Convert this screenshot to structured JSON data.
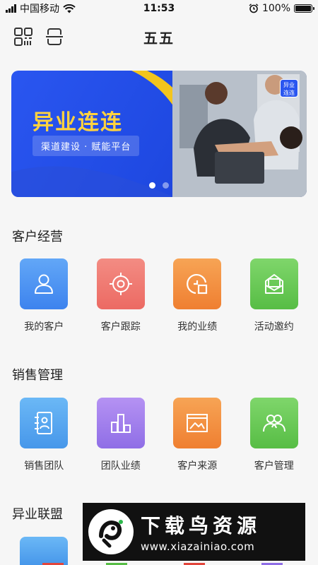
{
  "status_bar": {
    "carrier": "中国移动",
    "time": "11:53",
    "battery": "100%"
  },
  "header": {
    "title": "五五",
    "left_icons": [
      "qr-grid-icon",
      "scan-icon"
    ]
  },
  "banner": {
    "title": "异业连连",
    "subtitle": "渠道建设 · 赋能平台",
    "badge": "异业\n连连",
    "slide_count": 2,
    "active_slide": 1
  },
  "sections": [
    {
      "title": "客户经营",
      "items": [
        {
          "label": "我的客户",
          "icon": "user-icon",
          "color": "#4a8ff0"
        },
        {
          "label": "客户跟踪",
          "icon": "target-icon",
          "color": "#ee7569"
        },
        {
          "label": "我的业绩",
          "icon": "chart-pie-icon",
          "color": "#f2893c"
        },
        {
          "label": "活动邀约",
          "icon": "mail-icon",
          "color": "#63c650"
        }
      ]
    },
    {
      "title": "销售管理",
      "items": [
        {
          "label": "销售团队",
          "icon": "contact-book-icon",
          "color": "#52a2ef"
        },
        {
          "label": "团队业绩",
          "icon": "bar-chart-icon",
          "color": "#9d7aec"
        },
        {
          "label": "客户来源",
          "icon": "image-frame-icon",
          "color": "#f2893c"
        },
        {
          "label": "客户管理",
          "icon": "users-icon",
          "color": "#63c650"
        }
      ]
    },
    {
      "title": "异业联盟",
      "items": []
    }
  ],
  "watermark": {
    "title": "下载鸟资源",
    "url": "www.xiazainiao.com"
  }
}
